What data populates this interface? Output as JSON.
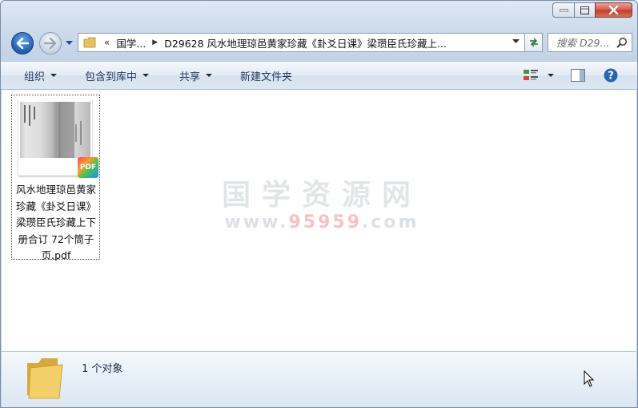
{
  "window": {
    "controls": {
      "minimize_icon": "minimize-icon",
      "maximize_icon": "maximize-icon",
      "close_icon": "close-icon"
    }
  },
  "nav": {
    "back_icon": "back-arrow-icon",
    "forward_icon": "forward-arrow-icon",
    "address": {
      "overflow": "«",
      "crumbs": [
        "国学...",
        "D29628 风水地理琼邑黄家珍藏《卦爻日课》梁瓒臣氏珍藏上..."
      ]
    },
    "search_placeholder": "搜索 D29..."
  },
  "toolbar": {
    "organize": "组织",
    "include_in_library": "包含到库中",
    "share": "共享",
    "new_folder": "新建文件夹"
  },
  "files": [
    {
      "name": "风水地理琼邑黄家珍藏《卦爻日课》梁瓒臣氏珍藏上下册合订 72个筒子页.pdf",
      "badge": "PDF"
    }
  ],
  "watermark": {
    "line1": "国学资源网",
    "line2_prefix": "www.",
    "line2_highlight": "95959",
    "line2_suffix": ".com"
  },
  "status": {
    "count": "1 个对象"
  },
  "colors": {
    "toolbar_text": "#1e395b",
    "close_button": "#c23c2c",
    "back_button": "#1f5cb3"
  }
}
